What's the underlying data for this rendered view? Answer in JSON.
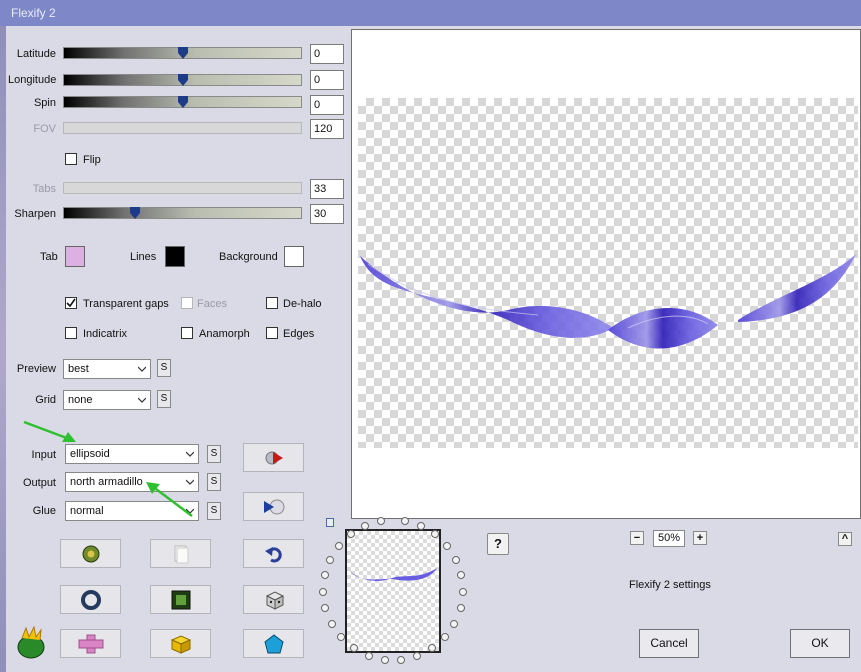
{
  "window": {
    "title": "Flexify 2"
  },
  "params": {
    "latitude": {
      "label": "Latitude",
      "value": "0",
      "level": 0.5
    },
    "longitude": {
      "label": "Longitude",
      "value": "0",
      "level": 0.5
    },
    "spin": {
      "label": "Spin",
      "value": "0",
      "level": 0.5
    },
    "fov": {
      "label": "FOV",
      "value": "120"
    },
    "flip": {
      "label": "Flip",
      "checked": false
    },
    "tabs": {
      "label": "Tabs",
      "value": "33"
    },
    "sharpen": {
      "label": "Sharpen",
      "value": "30",
      "level": 0.3
    }
  },
  "colors": {
    "tab": {
      "label": "Tab",
      "value": "#dcb0e2"
    },
    "lines": {
      "label": "Lines",
      "value": "#000000"
    },
    "background": {
      "label": "Background",
      "value": "#ffffff"
    }
  },
  "options": {
    "transparent_gaps": {
      "label": "Transparent gaps",
      "checked": true
    },
    "faces": {
      "label": "Faces",
      "checked": false
    },
    "de_halo": {
      "label": "De-halo",
      "checked": false
    },
    "indicatrix": {
      "label": "Indicatrix",
      "checked": false
    },
    "anamorph": {
      "label": "Anamorph",
      "checked": false
    },
    "edges": {
      "label": "Edges",
      "checked": false
    }
  },
  "dropdowns": {
    "preview": {
      "label": "Preview",
      "value": "best"
    },
    "grid": {
      "label": "Grid",
      "value": "none"
    },
    "input": {
      "label": "Input",
      "value": "ellipsoid"
    },
    "output": {
      "label": "Output",
      "value": "north armadillo"
    },
    "glue": {
      "label": "Glue",
      "value": "normal"
    }
  },
  "s_button_label": "S",
  "zoom": {
    "value": "50%",
    "minus": "−",
    "plus": "+"
  },
  "help_label": "?",
  "collapse_label": "^",
  "status_text": "Flexify 2 settings",
  "buttons": {
    "cancel": "Cancel",
    "ok": "OK"
  },
  "icons": {
    "forward": "play-forward-icon",
    "backward": "play-back-icon",
    "open": "open-icon",
    "copy": "page-icon",
    "undo": "undo-icon",
    "ring": "ring-icon",
    "frame": "frame-icon",
    "dice": "dice-icon",
    "cross": "cross-icon",
    "cube": "cube-icon",
    "pentagon": "pentagon-icon",
    "logo": "flexify-logo-icon"
  }
}
